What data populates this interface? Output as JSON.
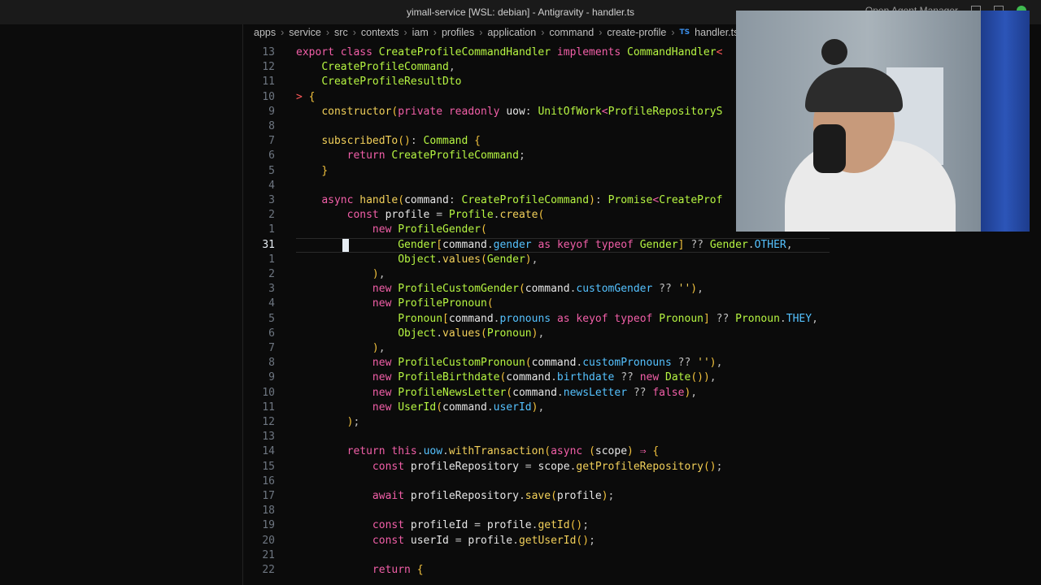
{
  "window": {
    "title": "yimall-service [WSL: debian] - Antigravity - handler.ts",
    "right_label": "Open Agent Manager"
  },
  "breadcrumb": [
    "apps",
    "service",
    "src",
    "contexts",
    "iam",
    "profiles",
    "application",
    "command",
    "create-profile",
    "handler.ts"
  ],
  "file_icon": "TS",
  "editor": {
    "current_line_number": "31",
    "lines": [
      {
        "n": "13",
        "tokens": [
          [
            "kw",
            "export "
          ],
          [
            "kw",
            "class "
          ],
          [
            "cls",
            "CreateProfileCommandHandler "
          ],
          [
            "kw",
            "implements "
          ],
          [
            "cls",
            "CommandHandler"
          ],
          [
            "err",
            "<"
          ]
        ]
      },
      {
        "n": "12",
        "tokens": [
          [
            "var",
            "    "
          ],
          [
            "cls",
            "CreateProfileCommand"
          ],
          [
            "punc",
            ","
          ]
        ]
      },
      {
        "n": "11",
        "tokens": [
          [
            "var",
            "    "
          ],
          [
            "cls",
            "CreateProfileResultDto"
          ]
        ]
      },
      {
        "n": "10",
        "tokens": [
          [
            "err",
            "> "
          ],
          [
            "br",
            "{"
          ]
        ]
      },
      {
        "n": "9",
        "tokens": [
          [
            "var",
            "    "
          ],
          [
            "fn",
            "constructor"
          ],
          [
            "br",
            "("
          ],
          [
            "kw",
            "private "
          ],
          [
            "kw",
            "readonly "
          ],
          [
            "var",
            "uow"
          ],
          [
            "punc",
            ": "
          ],
          [
            "cls",
            "UnitOfWork"
          ],
          [
            "kw",
            "<"
          ],
          [
            "cls",
            "ProfileRepositoryS"
          ]
        ]
      },
      {
        "n": "8",
        "tokens": []
      },
      {
        "n": "7",
        "tokens": [
          [
            "var",
            "    "
          ],
          [
            "fn",
            "subscribedTo"
          ],
          [
            "br",
            "()"
          ],
          [
            "punc",
            ": "
          ],
          [
            "cls",
            "Command "
          ],
          [
            "br",
            "{"
          ]
        ]
      },
      {
        "n": "6",
        "tokens": [
          [
            "var",
            "        "
          ],
          [
            "kw",
            "return "
          ],
          [
            "cls",
            "CreateProfileCommand"
          ],
          [
            "punc",
            ";"
          ]
        ]
      },
      {
        "n": "5",
        "tokens": [
          [
            "var",
            "    "
          ],
          [
            "br",
            "}"
          ]
        ]
      },
      {
        "n": "4",
        "tokens": []
      },
      {
        "n": "3",
        "tokens": [
          [
            "var",
            "    "
          ],
          [
            "kw",
            "async "
          ],
          [
            "fn",
            "handle"
          ],
          [
            "br",
            "("
          ],
          [
            "var",
            "command"
          ],
          [
            "punc",
            ": "
          ],
          [
            "cls",
            "CreateProfileCommand"
          ],
          [
            "br",
            ")"
          ],
          [
            "punc",
            ": "
          ],
          [
            "cls",
            "Promise"
          ],
          [
            "kw",
            "<"
          ],
          [
            "cls",
            "CreateProf"
          ]
        ]
      },
      {
        "n": "2",
        "tokens": [
          [
            "var",
            "        "
          ],
          [
            "kw",
            "const "
          ],
          [
            "var",
            "profile "
          ],
          [
            "punc",
            "= "
          ],
          [
            "cls",
            "Profile"
          ],
          [
            "punc",
            "."
          ],
          [
            "fn",
            "create"
          ],
          [
            "br",
            "("
          ]
        ]
      },
      {
        "n": "1",
        "tokens": [
          [
            "var",
            "            "
          ],
          [
            "kw",
            "new "
          ],
          [
            "cls",
            "ProfileGender"
          ],
          [
            "br",
            "("
          ]
        ]
      },
      {
        "n": "31",
        "current": true,
        "tokens": [
          [
            "var",
            "                "
          ],
          [
            "cls",
            "Gender"
          ],
          [
            "br",
            "["
          ],
          [
            "var",
            "command"
          ],
          [
            "punc",
            "."
          ],
          [
            "prop",
            "gender "
          ],
          [
            "kw",
            "as "
          ],
          [
            "kw",
            "keyof "
          ],
          [
            "kw",
            "typeof "
          ],
          [
            "cls",
            "Gender"
          ],
          [
            "br",
            "] "
          ],
          [
            "punc",
            "?? "
          ],
          [
            "cls",
            "Gender"
          ],
          [
            "punc",
            "."
          ],
          [
            "prop",
            "OTHER"
          ],
          [
            "punc",
            ","
          ]
        ]
      },
      {
        "n": "1",
        "tokens": [
          [
            "var",
            "                "
          ],
          [
            "cls",
            "Object"
          ],
          [
            "punc",
            "."
          ],
          [
            "fn",
            "values"
          ],
          [
            "br",
            "("
          ],
          [
            "cls",
            "Gender"
          ],
          [
            "br",
            ")"
          ],
          [
            "punc",
            ","
          ]
        ]
      },
      {
        "n": "2",
        "tokens": [
          [
            "var",
            "            "
          ],
          [
            "br",
            ")"
          ],
          [
            "punc",
            ","
          ]
        ]
      },
      {
        "n": "3",
        "tokens": [
          [
            "var",
            "            "
          ],
          [
            "kw",
            "new "
          ],
          [
            "cls",
            "ProfileCustomGender"
          ],
          [
            "br",
            "("
          ],
          [
            "var",
            "command"
          ],
          [
            "punc",
            "."
          ],
          [
            "prop",
            "customGender "
          ],
          [
            "punc",
            "?? "
          ],
          [
            "str",
            "''"
          ],
          [
            "br",
            ")"
          ],
          [
            "punc",
            ","
          ]
        ]
      },
      {
        "n": "4",
        "tokens": [
          [
            "var",
            "            "
          ],
          [
            "kw",
            "new "
          ],
          [
            "cls",
            "ProfilePronoun"
          ],
          [
            "br",
            "("
          ]
        ]
      },
      {
        "n": "5",
        "tokens": [
          [
            "var",
            "                "
          ],
          [
            "cls",
            "Pronoun"
          ],
          [
            "br",
            "["
          ],
          [
            "var",
            "command"
          ],
          [
            "punc",
            "."
          ],
          [
            "prop",
            "pronouns "
          ],
          [
            "kw",
            "as "
          ],
          [
            "kw",
            "keyof "
          ],
          [
            "kw",
            "typeof "
          ],
          [
            "cls",
            "Pronoun"
          ],
          [
            "br",
            "] "
          ],
          [
            "punc",
            "?? "
          ],
          [
            "cls",
            "Pronoun"
          ],
          [
            "punc",
            "."
          ],
          [
            "prop",
            "THEY"
          ],
          [
            "punc",
            ","
          ]
        ]
      },
      {
        "n": "6",
        "tokens": [
          [
            "var",
            "                "
          ],
          [
            "cls",
            "Object"
          ],
          [
            "punc",
            "."
          ],
          [
            "fn",
            "values"
          ],
          [
            "br",
            "("
          ],
          [
            "cls",
            "Pronoun"
          ],
          [
            "br",
            ")"
          ],
          [
            "punc",
            ","
          ]
        ]
      },
      {
        "n": "7",
        "tokens": [
          [
            "var",
            "            "
          ],
          [
            "br",
            ")"
          ],
          [
            "punc",
            ","
          ]
        ]
      },
      {
        "n": "8",
        "tokens": [
          [
            "var",
            "            "
          ],
          [
            "kw",
            "new "
          ],
          [
            "cls",
            "ProfileCustomPronoun"
          ],
          [
            "br",
            "("
          ],
          [
            "var",
            "command"
          ],
          [
            "punc",
            "."
          ],
          [
            "prop",
            "customPronouns "
          ],
          [
            "punc",
            "?? "
          ],
          [
            "str",
            "''"
          ],
          [
            "br",
            ")"
          ],
          [
            "punc",
            ","
          ]
        ]
      },
      {
        "n": "9",
        "tokens": [
          [
            "var",
            "            "
          ],
          [
            "kw",
            "new "
          ],
          [
            "cls",
            "ProfileBirthdate"
          ],
          [
            "br",
            "("
          ],
          [
            "var",
            "command"
          ],
          [
            "punc",
            "."
          ],
          [
            "prop",
            "birthdate "
          ],
          [
            "punc",
            "?? "
          ],
          [
            "kw",
            "new "
          ],
          [
            "cls",
            "Date"
          ],
          [
            "br",
            "()"
          ],
          [
            "br",
            ")"
          ],
          [
            "punc",
            ","
          ]
        ]
      },
      {
        "n": "10",
        "tokens": [
          [
            "var",
            "            "
          ],
          [
            "kw",
            "new "
          ],
          [
            "cls",
            "ProfileNewsLetter"
          ],
          [
            "br",
            "("
          ],
          [
            "var",
            "command"
          ],
          [
            "punc",
            "."
          ],
          [
            "prop",
            "newsLetter "
          ],
          [
            "punc",
            "?? "
          ],
          [
            "kw",
            "false"
          ],
          [
            "br",
            ")"
          ],
          [
            "punc",
            ","
          ]
        ]
      },
      {
        "n": "11",
        "tokens": [
          [
            "var",
            "            "
          ],
          [
            "kw",
            "new "
          ],
          [
            "cls",
            "UserId"
          ],
          [
            "br",
            "("
          ],
          [
            "var",
            "command"
          ],
          [
            "punc",
            "."
          ],
          [
            "prop",
            "userId"
          ],
          [
            "br",
            ")"
          ],
          [
            "punc",
            ","
          ]
        ]
      },
      {
        "n": "12",
        "tokens": [
          [
            "var",
            "        "
          ],
          [
            "br",
            ")"
          ],
          [
            "punc",
            ";"
          ]
        ]
      },
      {
        "n": "13",
        "tokens": []
      },
      {
        "n": "14",
        "tokens": [
          [
            "var",
            "        "
          ],
          [
            "kw",
            "return "
          ],
          [
            "kw",
            "this"
          ],
          [
            "punc",
            "."
          ],
          [
            "prop",
            "uow"
          ],
          [
            "punc",
            "."
          ],
          [
            "fn",
            "withTransaction"
          ],
          [
            "br",
            "("
          ],
          [
            "kw",
            "async "
          ],
          [
            "br",
            "("
          ],
          [
            "var",
            "scope"
          ],
          [
            "br",
            ") "
          ],
          [
            "kw",
            "⇒ "
          ],
          [
            "br",
            "{"
          ]
        ]
      },
      {
        "n": "15",
        "tokens": [
          [
            "var",
            "            "
          ],
          [
            "kw",
            "const "
          ],
          [
            "var",
            "profileRepository "
          ],
          [
            "punc",
            "= "
          ],
          [
            "var",
            "scope"
          ],
          [
            "punc",
            "."
          ],
          [
            "fn",
            "getProfileRepository"
          ],
          [
            "br",
            "()"
          ],
          [
            "punc",
            ";"
          ]
        ]
      },
      {
        "n": "16",
        "tokens": []
      },
      {
        "n": "17",
        "tokens": [
          [
            "var",
            "            "
          ],
          [
            "kw",
            "await "
          ],
          [
            "var",
            "profileRepository"
          ],
          [
            "punc",
            "."
          ],
          [
            "fn",
            "save"
          ],
          [
            "br",
            "("
          ],
          [
            "var",
            "profile"
          ],
          [
            "br",
            ")"
          ],
          [
            "punc",
            ";"
          ]
        ]
      },
      {
        "n": "18",
        "tokens": []
      },
      {
        "n": "19",
        "tokens": [
          [
            "var",
            "            "
          ],
          [
            "kw",
            "const "
          ],
          [
            "var",
            "profileId "
          ],
          [
            "punc",
            "= "
          ],
          [
            "var",
            "profile"
          ],
          [
            "punc",
            "."
          ],
          [
            "fn",
            "getId"
          ],
          [
            "br",
            "()"
          ],
          [
            "punc",
            ";"
          ]
        ]
      },
      {
        "n": "20",
        "tokens": [
          [
            "var",
            "            "
          ],
          [
            "kw",
            "const "
          ],
          [
            "var",
            "userId "
          ],
          [
            "punc",
            "= "
          ],
          [
            "var",
            "profile"
          ],
          [
            "punc",
            "."
          ],
          [
            "fn",
            "getUserId"
          ],
          [
            "br",
            "()"
          ],
          [
            "punc",
            ";"
          ]
        ]
      },
      {
        "n": "21",
        "tokens": []
      },
      {
        "n": "22",
        "tokens": [
          [
            "var",
            "            "
          ],
          [
            "kw",
            "return "
          ],
          [
            "br",
            "{"
          ]
        ]
      }
    ]
  },
  "colors": {
    "keyword": "#f25fa8",
    "class": "#b6f542",
    "function": "#f2d05a",
    "property": "#55c2ff"
  }
}
